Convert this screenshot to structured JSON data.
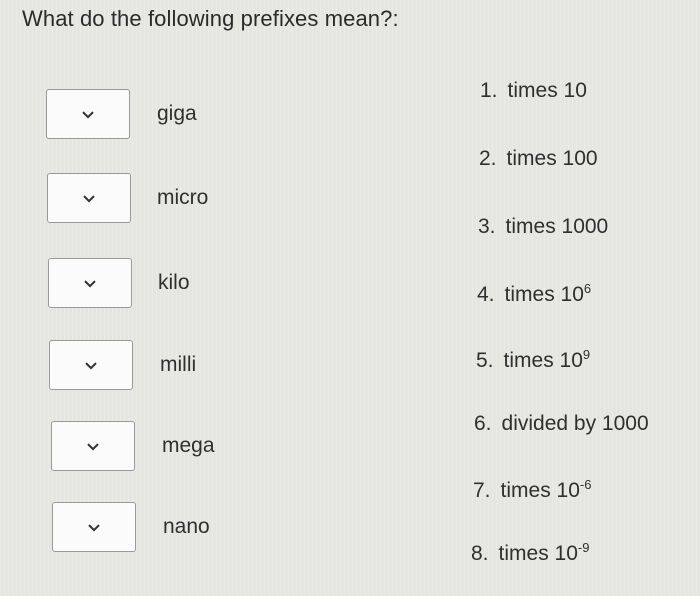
{
  "question": "What do the following prefixes mean?:",
  "items": [
    {
      "term": "giga"
    },
    {
      "term": "micro"
    },
    {
      "term": "kilo"
    },
    {
      "term": "milli"
    },
    {
      "term": "mega"
    },
    {
      "term": "nano"
    }
  ],
  "options": [
    {
      "num": "1.",
      "text": "times 10",
      "sup": ""
    },
    {
      "num": "2.",
      "text": "times 100",
      "sup": ""
    },
    {
      "num": "3.",
      "text": "times 1000",
      "sup": ""
    },
    {
      "num": "4.",
      "text": "times 10",
      "sup": "6"
    },
    {
      "num": "5.",
      "text": "times 10",
      "sup": "9"
    },
    {
      "num": "6.",
      "text": "divided by 1000",
      "sup": ""
    },
    {
      "num": "7.",
      "text": "times 10",
      "sup": "-6"
    },
    {
      "num": "8.",
      "text": "times 10",
      "sup": "-9"
    }
  ]
}
